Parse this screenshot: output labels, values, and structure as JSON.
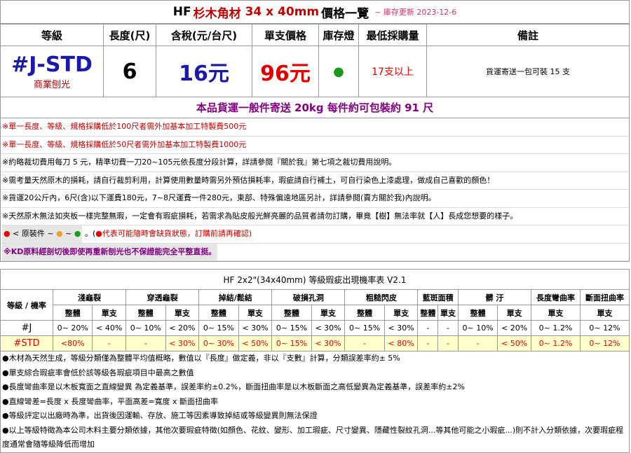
{
  "header": {
    "prefix": "HF",
    "product": "杉木角材",
    "size": "34 x 40mm",
    "suffix": "價格一覽",
    "date": "~ 庫存更新 2023-12-6"
  },
  "spec": {
    "columns": [
      "等級",
      "長度(尺)",
      "含稅(元/台尺)",
      "單支價格",
      "庫存燈",
      "最低採購量",
      "備註"
    ],
    "grade": "#J-STD",
    "grade_sub": "商業刨光",
    "length": "6",
    "price_per_foot": "16元",
    "unit_price": "96元",
    "stock_dot": "●",
    "min_qty": "17支以上",
    "remark": "貨運寄送一包可裝 15 支"
  },
  "shipping_banner": "本品貨運一般件寄送 20kg 每件約可包裝約 91 尺",
  "rules": [
    {
      "text": "※單一長度、等級、規格採購低於100尺者需外加基本加工特製費500元",
      "color": "red"
    },
    {
      "text": "※單一長度、等級、規格採購低於50尺者需外加基本加工特製費1000元",
      "color": "red"
    },
    {
      "text": "※約略裁切費用每刀 5 元，精準切費一刀20~105元依長度分段計算，詳請參閱『關於我』第七項之裁切費用說明。",
      "color": "black"
    },
    {
      "text": "※需考量天然原木的損耗，請自行裁剪利用，計算使用數量時需另外預估損耗率，瑕疵請自行補土，可自行染色上漆處理，做成自己喜歡的顏色！",
      "color": "black"
    },
    {
      "text": "※貨運20公斤內，6尺(含)以下運費180元，7~8尺運費一件280元，東部、特殊偏遠地區另計，詳請參閱(賣方關於我)內說明。",
      "color": "black"
    },
    {
      "text": "※天然原木無法如夾板一樣完整無瑕，一定會有瑕疵損耗，若需求為貼皮般光鮮亮麗的品質者請勿訂購，畢竟【樹】無法率就【人】長成您想要的樣子。",
      "color": "black"
    }
  ],
  "legend": {
    "label": "< 原裝件 ~",
    "sep": "~",
    "note": "代表可能隨時會缺貨狀態，訂購前請再確認)",
    "colors": [
      "#e00000",
      "#f0a030",
      "#1a9a1a"
    ]
  },
  "kd_note": "※KD原料經剖切後即使再重新刨光也不保證能完全平整直挺。",
  "defect_table": {
    "title": "HF 2x2\"(34x40mm) 等級瑕疵出現機率表 V2.1",
    "row_header": "等級 / 機率",
    "groups": [
      "淺龜裂",
      "穿透龜裂",
      "掉結/鬆結",
      "破損孔洞",
      "粗糙閃皮",
      "藍斑面積",
      "髒 汙",
      "長度彎曲率",
      "斷面扭曲率"
    ],
    "sub_whole": "整體",
    "sub_single": "單支",
    "rows": [
      {
        "grade": "#J",
        "cells": [
          "0~ 20%",
          "< 40%",
          "0~ 10%",
          "< 20%",
          "0~ 15%",
          "< 30%",
          "0~ 15%",
          "< 30%",
          "0~ 15%",
          "< 30%",
          "-",
          "-",
          "0~ 10%",
          "< 20%",
          "0~ 1.2%",
          "0~ 12%"
        ]
      },
      {
        "grade": "#STD",
        "cells": [
          "<80%",
          "-",
          "-",
          "< 30%",
          "0~ 30%",
          "< 50%",
          "0~ 15%",
          "< 30%",
          "-",
          "< 80%",
          "-",
          "-",
          "-",
          "< 50%",
          "0~ 1.2%",
          "0~ 12%"
        ]
      }
    ]
  },
  "footnotes": [
    "●木材為天然生成，等級分類僅為整體平均值概略，數值以『長度』做定義，非以『支數』計算，分類誤差率約± 5%",
    "●單支綜合瑕疵率會低於該等級各瑕疵項目中最高之數值",
    "●長度彎曲率是以木板寬面之直線變異 為定義基準，誤差率約±0.2%，斷面扭曲率是以木板斷面之高低變異為定義基準，誤差率約±2%",
    "●直線彎差=長度 x 長度彎曲率，平面高差=寬度 x 斷面扭曲率",
    "●等級評定以出廠時為準，出貨後因運輸、存放、施工等因素導致掉結或等級變異則無法保證",
    "●以上等級特徵為本公司木料主要分類依據，其他次要瑕疵特徵(如顏色、花紋、變形、加工瑕疵、尺寸變異、隱藏性裂紋孔洞...等其他可能之小瑕疵...)則不計入分類依據，次要瑕疵程度通常會隨等級降低而增加"
  ]
}
